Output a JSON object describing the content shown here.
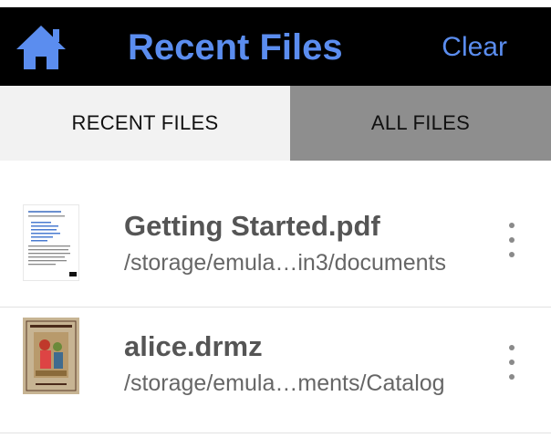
{
  "app_bar": {
    "title": "Recent Files",
    "clear_label": "Clear",
    "home_icon": "home-icon",
    "accent_color": "#5b8def",
    "background": "#000000"
  },
  "tabs": [
    {
      "label": "RECENT FILES",
      "selected": true
    },
    {
      "label": "ALL FILES",
      "selected": false
    }
  ],
  "files": [
    {
      "name": "Getting Started.pdf",
      "path": "/storage/emula…in3/documents",
      "thumbnail": "pdf-page-thumbnail",
      "menu_icon": "more-vertical-icon"
    },
    {
      "name": "alice.drmz",
      "path": "/storage/emula…ments/Catalog",
      "thumbnail": "book-cover-thumbnail",
      "menu_icon": "more-vertical-icon"
    }
  ]
}
